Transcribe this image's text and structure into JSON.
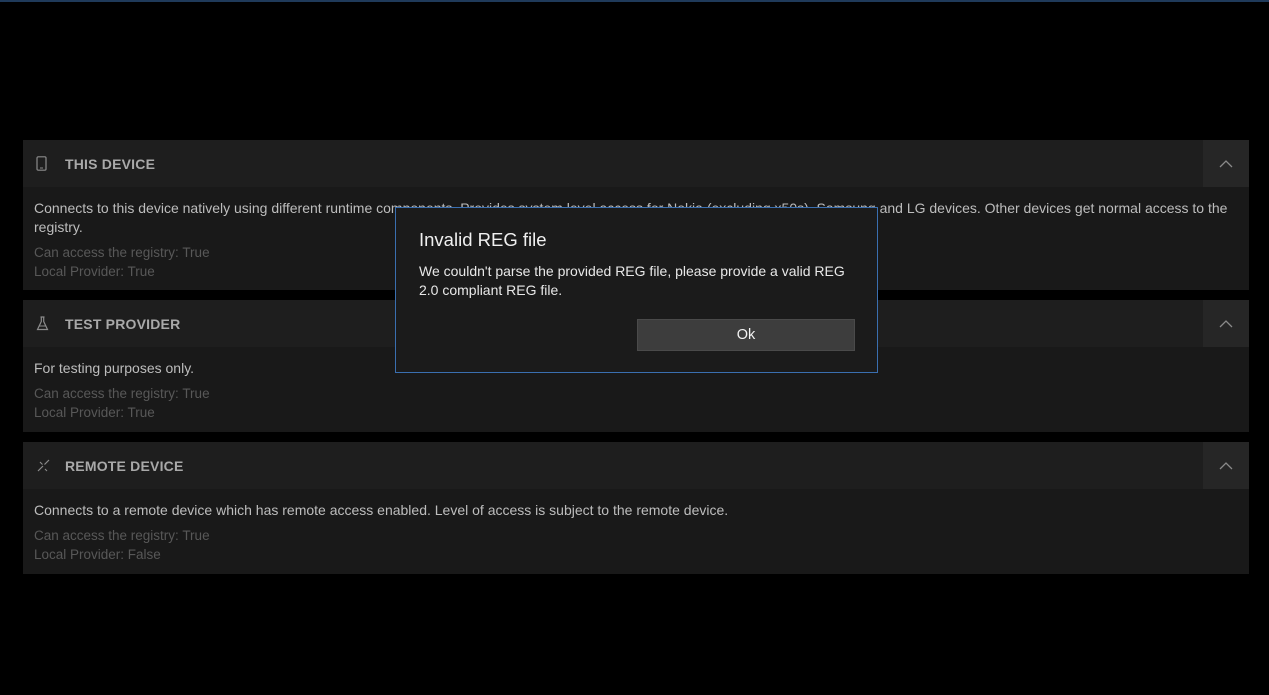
{
  "providers": [
    {
      "icon": "phone-icon",
      "title": "THIS DEVICE",
      "description": "Connects to this device natively using different runtime components. Provides system level access for Nokia (excluding x50s), Samsung and LG devices. Other devices get normal access to the registry.",
      "registry": "Can access the registry: True",
      "local": "Local Provider: True"
    },
    {
      "icon": "flask-icon",
      "title": "TEST PROVIDER",
      "description": "For testing purposes only.",
      "registry": "Can access the registry: True",
      "local": "Local Provider: True"
    },
    {
      "icon": "remote-link-icon",
      "title": "REMOTE DEVICE",
      "description": "Connects to a remote device which has remote access enabled. Level of access is subject to the remote device.",
      "registry": "Can access the registry: True",
      "local": "Local Provider: False"
    }
  ],
  "dialog": {
    "title": "Invalid REG file",
    "message": "We couldn't parse the provided REG file, please provide a valid REG 2.0 compliant REG file.",
    "ok_label": "Ok"
  },
  "colors": {
    "accent": "#3a6fb0",
    "background": "#000000",
    "panel": "#191919"
  }
}
